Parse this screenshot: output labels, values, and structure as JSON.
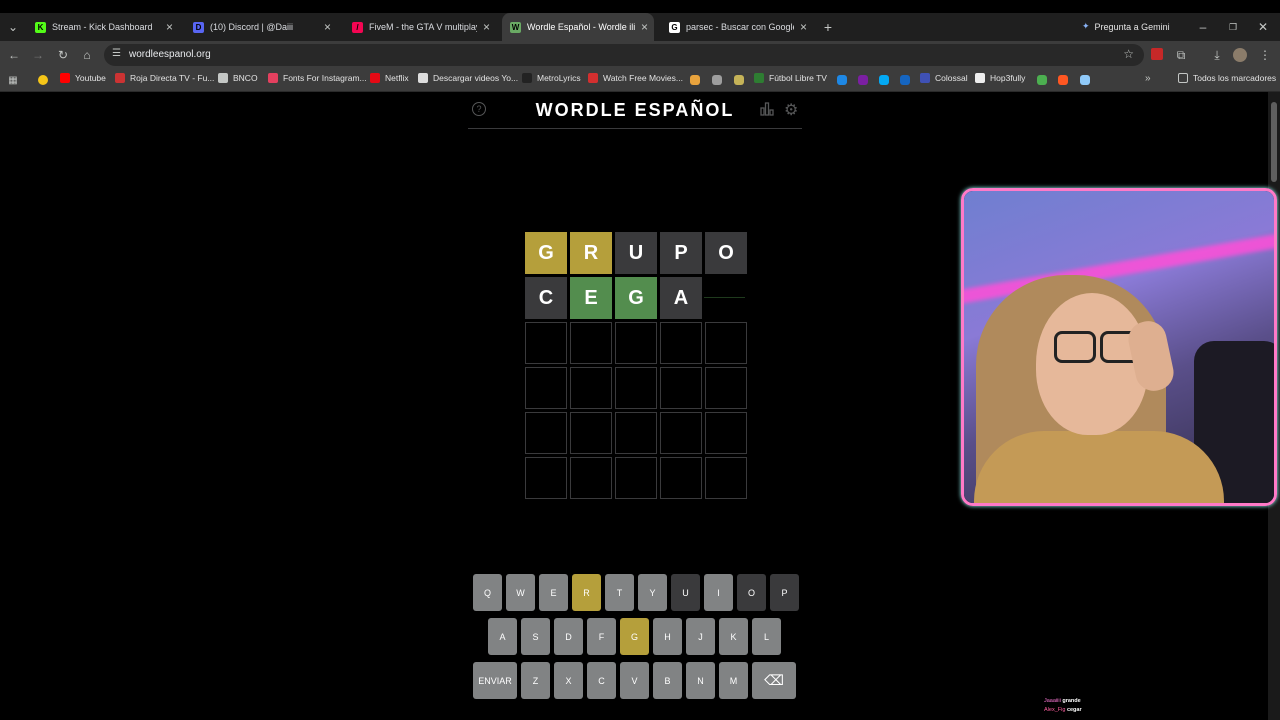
{
  "browser": {
    "tabs": [
      {
        "title": "Stream - Kick Dashboard",
        "favicon": "kick-icon",
        "color": "#53fc18",
        "letter": "K"
      },
      {
        "title": "(10) Discord | @Daiii",
        "favicon": "discord-icon",
        "color": "#5865f2",
        "letter": "D"
      },
      {
        "title": "FiveM - the GTA V multiplayer",
        "favicon": "fivem-icon",
        "color": "#f40552",
        "letter": "/"
      },
      {
        "title": "Wordle Español - Wordle ilimit",
        "favicon": "wordle-icon",
        "color": "#6aaa64",
        "letter": "W"
      },
      {
        "title": "parsec - Buscar con Google",
        "favicon": "google-icon",
        "color": "#ffffff",
        "letter": "G"
      }
    ],
    "gemini_label": "Pregunta a Gemini",
    "url": "wordleespanol.org",
    "bookmarks": [
      {
        "label": "Youtube",
        "color": "#ff0000"
      },
      {
        "label": "Roja Directa TV - Fu...",
        "color": "#cc3333"
      },
      {
        "label": "BNCO",
        "color": "#c4c7c5"
      },
      {
        "label": "Fonts For Instagram...",
        "color": "#e4405f"
      },
      {
        "label": "Netflix",
        "color": "#e50914"
      },
      {
        "label": "Descargar videos Yo...",
        "color": "#dddddd"
      },
      {
        "label": "MetroLyrics",
        "color": "#222222"
      },
      {
        "label": "Watch Free Movies...",
        "color": "#d32f2f"
      },
      {
        "label": "Fútbol Libre TV",
        "color": "#2e7d32"
      },
      {
        "label": "Colossal",
        "color": "#3f51b5"
      },
      {
        "label": "Hop3fully",
        "color": "#eeeeee"
      }
    ],
    "all_bookmarks_label": "Todos los marcadores"
  },
  "game": {
    "title": "WORDLE ESPAÑOL",
    "board": [
      [
        {
          "l": "G",
          "s": "present"
        },
        {
          "l": "R",
          "s": "present"
        },
        {
          "l": "U",
          "s": "absent"
        },
        {
          "l": "P",
          "s": "absent"
        },
        {
          "l": "O",
          "s": "absent"
        }
      ],
      [
        {
          "l": "C",
          "s": "absent"
        },
        {
          "l": "E",
          "s": "correct"
        },
        {
          "l": "G",
          "s": "correct"
        },
        {
          "l": "A",
          "s": "absent"
        },
        {
          "l": "",
          "s": "pending"
        }
      ],
      [
        {
          "l": "",
          "s": "empty"
        },
        {
          "l": "",
          "s": "empty"
        },
        {
          "l": "",
          "s": "empty"
        },
        {
          "l": "",
          "s": "empty"
        },
        {
          "l": "",
          "s": "empty"
        }
      ],
      [
        {
          "l": "",
          "s": "empty"
        },
        {
          "l": "",
          "s": "empty"
        },
        {
          "l": "",
          "s": "empty"
        },
        {
          "l": "",
          "s": "empty"
        },
        {
          "l": "",
          "s": "empty"
        }
      ],
      [
        {
          "l": "",
          "s": "empty"
        },
        {
          "l": "",
          "s": "empty"
        },
        {
          "l": "",
          "s": "empty"
        },
        {
          "l": "",
          "s": "empty"
        },
        {
          "l": "",
          "s": "empty"
        }
      ],
      [
        {
          "l": "",
          "s": "empty"
        },
        {
          "l": "",
          "s": "empty"
        },
        {
          "l": "",
          "s": "empty"
        },
        {
          "l": "",
          "s": "empty"
        },
        {
          "l": "",
          "s": "empty"
        }
      ]
    ],
    "keyboard": [
      [
        {
          "k": "Q",
          "s": "default"
        },
        {
          "k": "W",
          "s": "default"
        },
        {
          "k": "E",
          "s": "default"
        },
        {
          "k": "R",
          "s": "present"
        },
        {
          "k": "T",
          "s": "default"
        },
        {
          "k": "Y",
          "s": "default"
        },
        {
          "k": "U",
          "s": "absent"
        },
        {
          "k": "I",
          "s": "default"
        },
        {
          "k": "O",
          "s": "absent"
        },
        {
          "k": "P",
          "s": "absent"
        }
      ],
      [
        {
          "k": "A",
          "s": "default"
        },
        {
          "k": "S",
          "s": "default"
        },
        {
          "k": "D",
          "s": "default"
        },
        {
          "k": "F",
          "s": "default"
        },
        {
          "k": "G",
          "s": "present"
        },
        {
          "k": "H",
          "s": "default"
        },
        {
          "k": "J",
          "s": "default"
        },
        {
          "k": "K",
          "s": "default"
        },
        {
          "k": "L",
          "s": "default"
        }
      ],
      [
        {
          "k": "ENVIAR",
          "s": "default"
        },
        {
          "k": "Z",
          "s": "default"
        },
        {
          "k": "X",
          "s": "default"
        },
        {
          "k": "C",
          "s": "default"
        },
        {
          "k": "V",
          "s": "default"
        },
        {
          "k": "B",
          "s": "default"
        },
        {
          "k": "N",
          "s": "default"
        },
        {
          "k": "M",
          "s": "default"
        },
        {
          "k": "⌫",
          "s": "default"
        }
      ]
    ]
  },
  "chat": [
    {
      "user": "Jaaaiiii",
      "message": "grande"
    },
    {
      "user": "Alex_Fig",
      "message": "cegar"
    }
  ],
  "colors": {
    "present": "#b59f3b",
    "correct": "#538d4e",
    "absent": "#3a3a3c",
    "key": "#818384",
    "webcam_border": "#ff7ac8"
  }
}
